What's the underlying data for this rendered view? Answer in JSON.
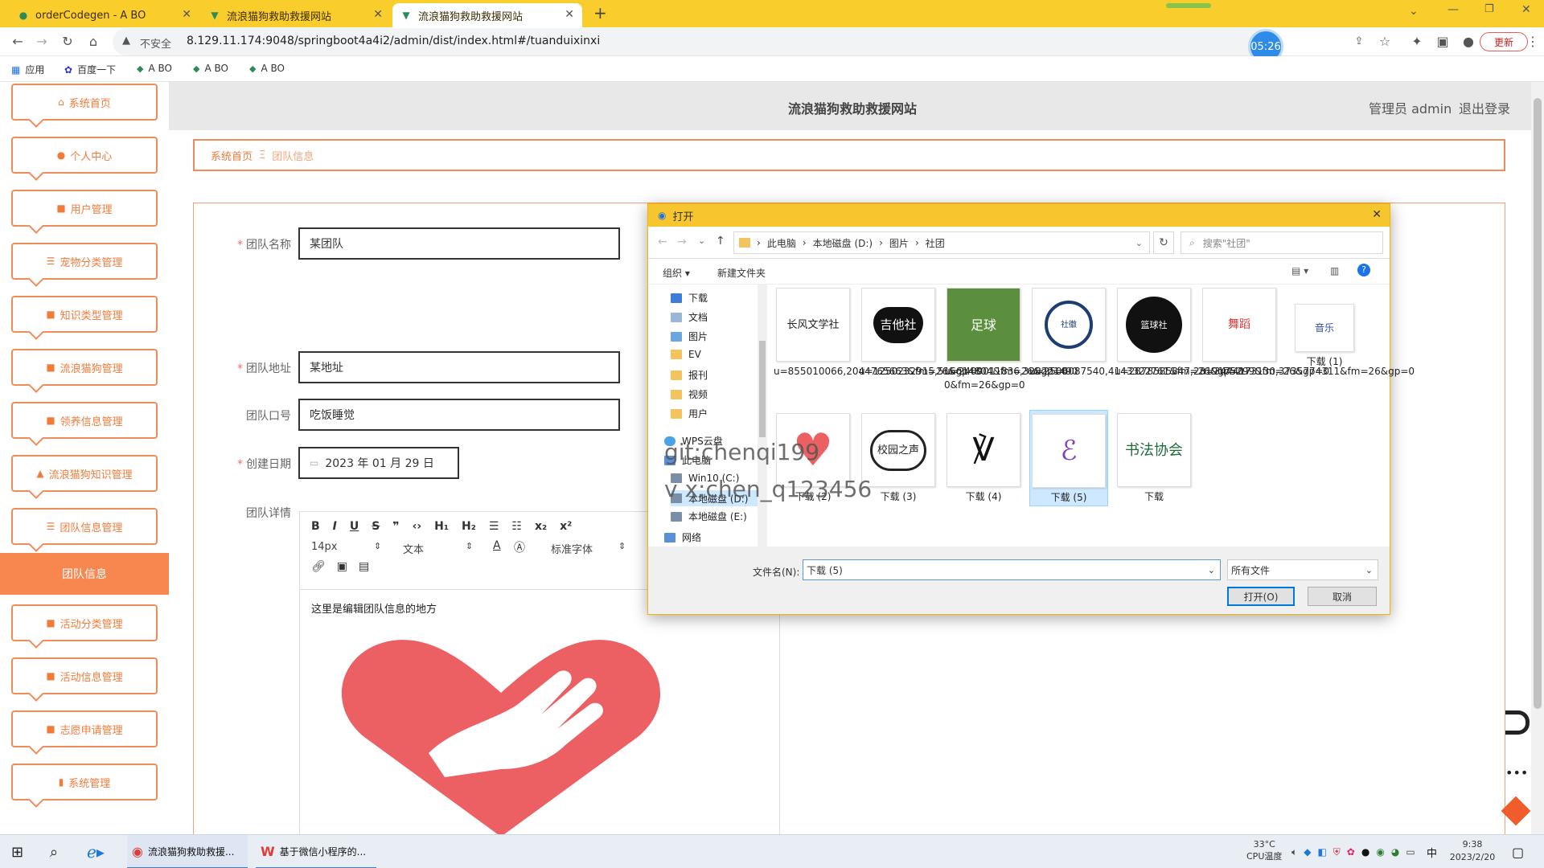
{
  "browser": {
    "tabs": [
      {
        "title": "orderCodegen - A BO"
      },
      {
        "title": "流浪猫狗救助救援网站"
      },
      {
        "title": "流浪猫狗救助救援网站"
      }
    ],
    "new_tab": "+",
    "security": "不安全",
    "url": "8.129.11.174:9048/springboot4a4i2/admin/dist/index.html#/tuanduixinxi",
    "timer": "05:26",
    "update_label": "更新",
    "bookmarks": [
      "应用",
      "百度一下",
      "A BO",
      "A BO",
      "A BO"
    ]
  },
  "sidebar": {
    "items": [
      {
        "label": "系统首页",
        "icon": "⌂"
      },
      {
        "label": "个人中心",
        "icon": "●"
      },
      {
        "label": "用户管理",
        "icon": "■"
      },
      {
        "label": "宠物分类管理",
        "icon": "☰"
      },
      {
        "label": "知识类型管理",
        "icon": "■"
      },
      {
        "label": "流浪猫狗管理",
        "icon": "■"
      },
      {
        "label": "领养信息管理",
        "icon": "■"
      },
      {
        "label": "流浪猫狗知识管理",
        "icon": "▲"
      },
      {
        "label": "团队信息管理",
        "icon": "☰"
      }
    ],
    "active_sub": "团队信息",
    "items2": [
      {
        "label": "活动分类管理",
        "icon": "■"
      },
      {
        "label": "活动信息管理",
        "icon": "■"
      },
      {
        "label": "志愿申请管理",
        "icon": "■"
      },
      {
        "label": "系统管理",
        "icon": "▮"
      }
    ]
  },
  "header": {
    "title": "流浪猫狗救助救援网站",
    "user": "管理员 admin",
    "logout": "退出登录"
  },
  "breadcrumb": {
    "home": "系统首页",
    "sep": "Ξ",
    "current": "团队信息"
  },
  "form": {
    "name_label": "团队名称",
    "name_value": "某团队",
    "address_label": "团队地址",
    "address_value": "某地址",
    "slogan_label": "团队口号",
    "slogan_value": "吃饭睡觉",
    "date_label": "创建日期",
    "date_value": "2023 年 01 月 29 日",
    "detail_label": "团队详情",
    "editor_size": "14px",
    "editor_format": "文本",
    "editor_font": "标准字体",
    "editor_content": "这里是编辑团队信息的地方"
  },
  "dialog": {
    "title": "打开",
    "path": [
      "此电脑",
      "本地磁盘 (D:)",
      "图片",
      "社团"
    ],
    "search_placeholder": "搜索\"社团\"",
    "organize": "组织 ▾",
    "new_folder": "新建文件夹",
    "nav": [
      "下载",
      "文档",
      "图片",
      "EV",
      "报刊",
      "视频",
      "用户",
      "WPS云盘",
      "此电脑",
      "Win10 (C:)",
      "本地磁盘 (D:)",
      "本地磁盘 (E:)",
      "网络"
    ],
    "files": [
      {
        "name": "u=855010066,2044765663&fm=26&gp=0",
        "thumb": "长风文学社"
      },
      {
        "name": "u=1250232915,516614804&fm=26&gp=0",
        "thumb": "吉他社"
      },
      {
        "name": "u=2409011836,328221490 0&fm=26&gp=0",
        "thumb": "足球"
      },
      {
        "name": "u=2506087540,4143322761&fm=26&gp=0",
        "thumb": "社徽"
      },
      {
        "name": "u=2878585847,2319175299&fm=26&gp=0",
        "thumb": "篮球社"
      },
      {
        "name": "u=3444173130,3735774311&fm=26&gp=0",
        "thumb": "舞蹈"
      },
      {
        "name": "下载 (1)",
        "thumb": "音乐"
      },
      {
        "name": "下载 (2)",
        "thumb": "爱心"
      },
      {
        "name": "下载 (3)",
        "thumb": "校园之声"
      },
      {
        "name": "下载 (4)",
        "thumb": "标志"
      },
      {
        "name": "下载 (5)",
        "thumb": "标志"
      },
      {
        "name": "下载",
        "thumb": "书法协会"
      }
    ],
    "filename_label": "文件名(N):",
    "filename_value": "下载 (5)",
    "filetype": "所有文件",
    "open_button": "打开(O)",
    "cancel_button": "取消"
  },
  "watermark": {
    "line1": "git:chenqi199",
    "line2": "v x:chen_q123456"
  },
  "taskbar": {
    "app1": "流浪猫狗救助救援...",
    "app2": "基于微信小程序的...",
    "temp": "33°C",
    "temp_label": "CPU温度",
    "ime": "中",
    "time": "9:38",
    "date": "2023/2/20"
  },
  "colors": {
    "accent": "#f8874f",
    "tabbar": "#f8cd2c",
    "dialog_title": "#f7c52d",
    "selection": "#cde8ff"
  }
}
